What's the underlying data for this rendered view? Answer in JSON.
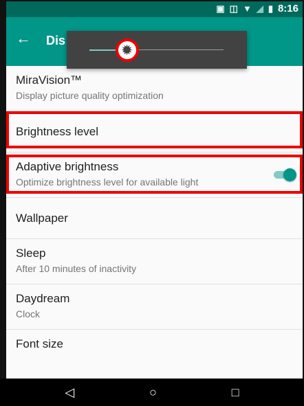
{
  "status_bar": {
    "time": "8:16",
    "icons": [
      "cast-icon",
      "vibrate-icon",
      "wifi-icon",
      "no-signal-icon",
      "battery-icon"
    ]
  },
  "app_bar": {
    "title": "Dis",
    "back_icon": "arrow-left-icon"
  },
  "brightness_slider": {
    "level": 0.28,
    "thumb_icon": "brightness-icon"
  },
  "settings": [
    {
      "id": "miravision",
      "title": "MiraVision™",
      "subtitle": "Display picture quality optimization"
    },
    {
      "id": "brightness-level",
      "title": "Brightness level"
    },
    {
      "id": "adaptive-brightness",
      "title": "Adaptive brightness",
      "subtitle": "Optimize brightness level for available light",
      "toggle_on": true
    },
    {
      "id": "wallpaper",
      "title": "Wallpaper"
    },
    {
      "id": "sleep",
      "title": "Sleep",
      "subtitle": "After 10 minutes of inactivity"
    },
    {
      "id": "daydream",
      "title": "Daydream",
      "subtitle": "Clock"
    },
    {
      "id": "font-size",
      "title": "Font size"
    }
  ],
  "nav_bar": {
    "icons": [
      "back-triangle-icon",
      "home-circle-icon",
      "recents-square-icon"
    ]
  },
  "colors": {
    "accent": "#009688",
    "status_bar": "#00695c",
    "highlight": "#e00000"
  }
}
